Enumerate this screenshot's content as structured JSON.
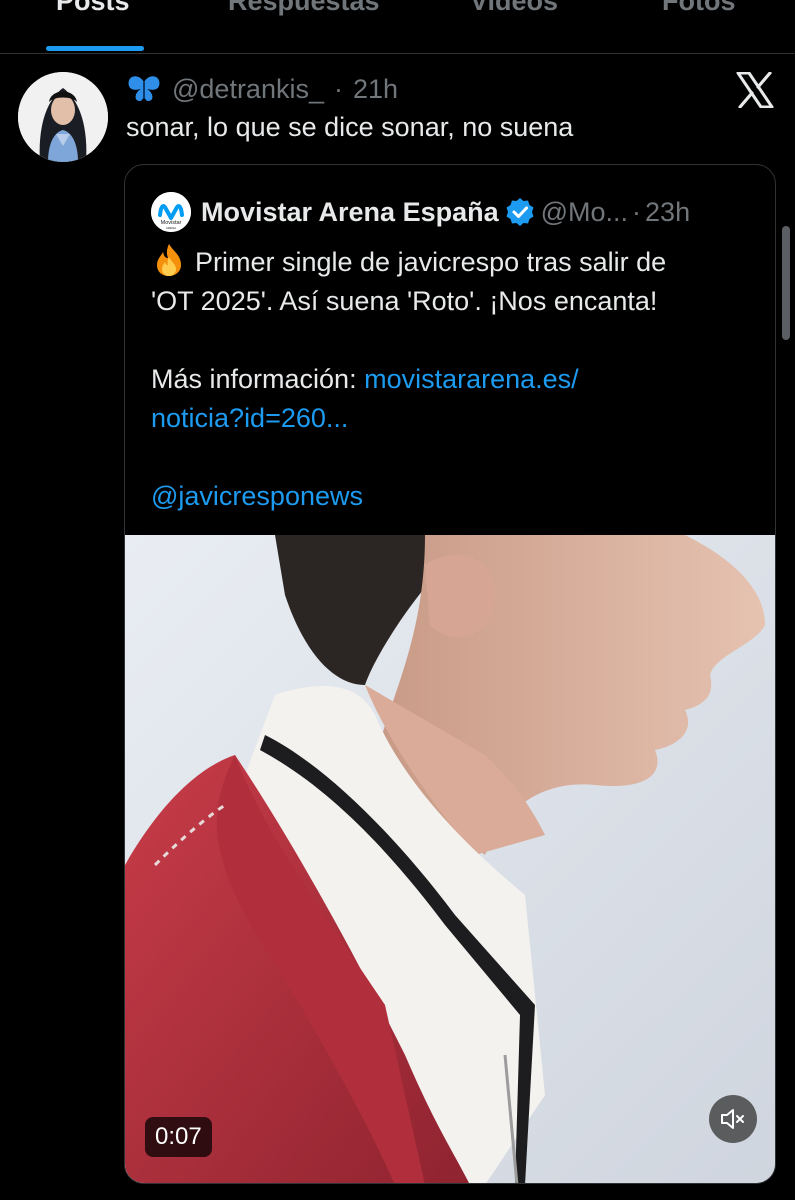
{
  "tabs": [
    {
      "label": "Posts",
      "active": true
    },
    {
      "label": "Respuestas",
      "active": false
    },
    {
      "label": "Videos",
      "active": false
    },
    {
      "label": "Fotos",
      "active": false
    }
  ],
  "post": {
    "handle": "@detrankis_",
    "separator": "·",
    "time": "21h",
    "text": "sonar, lo que se dice sonar, no suena",
    "header_icon": "butterfly-icon",
    "platform_icon": "x-logo-icon"
  },
  "quote": {
    "name": "Movistar Arena España",
    "verified": true,
    "handle": "@Mo...",
    "separator": "·",
    "time": "23h",
    "avatar_text": "Movistar",
    "avatar_subtext": "ARENA",
    "line1": "Primer single de javicrespo tras salir de",
    "line2": "'OT 2025'. Así suena 'Roto'. ¡Nos encanta!",
    "info_label": "Más información: ",
    "link_part1": "movistararena.es/",
    "link_part2": "noticia?id=260...",
    "mention": "@javicresponews",
    "video": {
      "duration": "0:07",
      "muted": true
    }
  },
  "colors": {
    "accent": "#1d9bf0",
    "background": "#000000",
    "text": "#e7e9ea",
    "muted": "#71767b",
    "border": "#2f3336"
  }
}
